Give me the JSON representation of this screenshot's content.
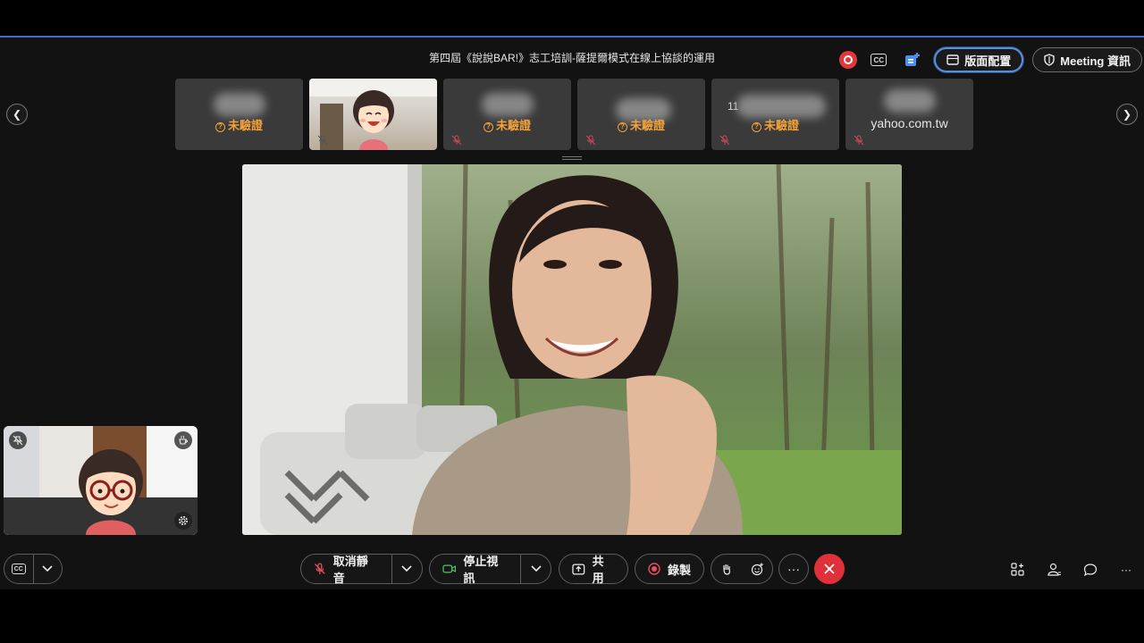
{
  "meeting": {
    "title": "第四屆《說說BAR!》志工培訓-薩提爾模式在線上協談的運用"
  },
  "top_actions": {
    "layout_label": "版面配置",
    "meeting_info_label": "Meeting 資訊"
  },
  "participants": [
    {
      "type": "blurred",
      "status": "未驗證"
    },
    {
      "type": "video"
    },
    {
      "type": "blurred",
      "status": "未驗證"
    },
    {
      "type": "blurred",
      "status": "未驗證"
    },
    {
      "type": "blurred",
      "number": "11",
      "status": "未驗證"
    },
    {
      "type": "email",
      "label": "yahoo.com.tw"
    }
  ],
  "toolbar": {
    "unmute_label": "取消靜音",
    "stop_video_label": "停止視訊",
    "share_label": "共用",
    "record_label": "錄製",
    "more_label": "···"
  },
  "colors": {
    "accent": "#5b8fd9",
    "warning": "#f2a33a",
    "record": "#e2373c",
    "end_call": "#e0303a",
    "background": "#121212"
  },
  "icons": [
    "record-icon",
    "captions-icon",
    "apps-icon",
    "layout-icon",
    "shield-icon",
    "microphone-muted-icon",
    "camera-icon",
    "share-icon",
    "record-icon",
    "raise-hand-icon",
    "reactions-icon",
    "more-icon",
    "close-icon",
    "participants-icon",
    "chat-icon",
    "pin-icon",
    "coffee-icon",
    "gear-icon"
  ]
}
